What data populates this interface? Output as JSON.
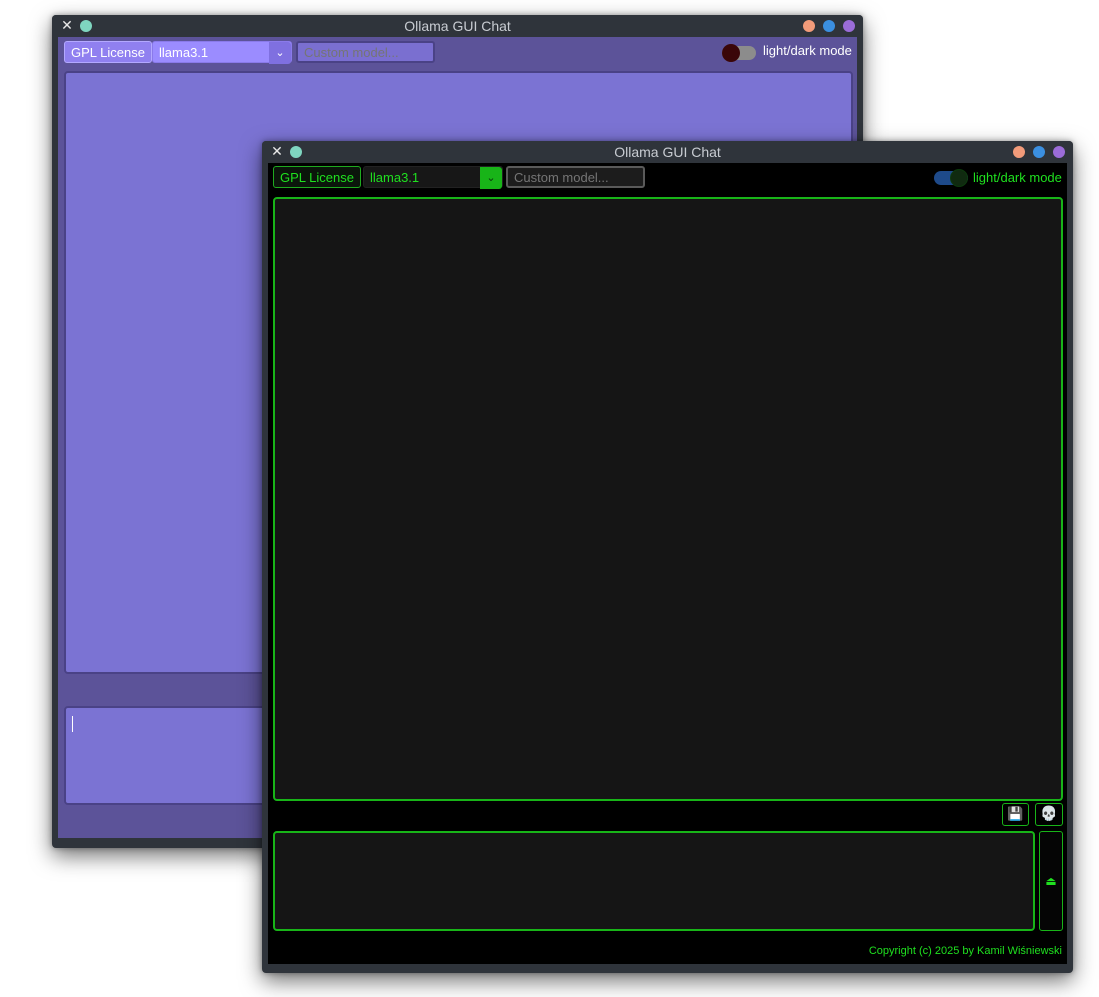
{
  "light_window": {
    "title": "Ollama GUI Chat",
    "close_glyph": "✕",
    "license_button": "GPL License",
    "model_select": {
      "value": "llama3.1",
      "arrow": "⌄"
    },
    "custom_model_input": {
      "placeholder": "Custom model...",
      "value": ""
    },
    "theme_toggle": {
      "label": "light/dark mode",
      "state": "off"
    },
    "colors": {
      "background": "#5c5399",
      "panel": "#7b73d3",
      "accent": "#9b8cff"
    }
  },
  "dark_window": {
    "title": "Ollama GUI Chat",
    "close_glyph": "✕",
    "license_button": "GPL License",
    "model_select": {
      "value": "llama3.1",
      "arrow": "⌄"
    },
    "custom_model_input": {
      "placeholder": "Custom model...",
      "value": ""
    },
    "theme_toggle": {
      "label": "light/dark mode",
      "state": "on"
    },
    "actions": {
      "save_icon": "floppy-disk-icon",
      "save_glyph": "💾",
      "clear_icon": "skull-icon",
      "clear_glyph": "💀",
      "send_icon": "send-icon",
      "send_glyph": "⏏"
    },
    "copyright": "Copyright (c) 2025 by Kamil Wiśniewski",
    "colors": {
      "background": "#000000",
      "panel": "#151515",
      "accent": "#1fe01f"
    }
  }
}
